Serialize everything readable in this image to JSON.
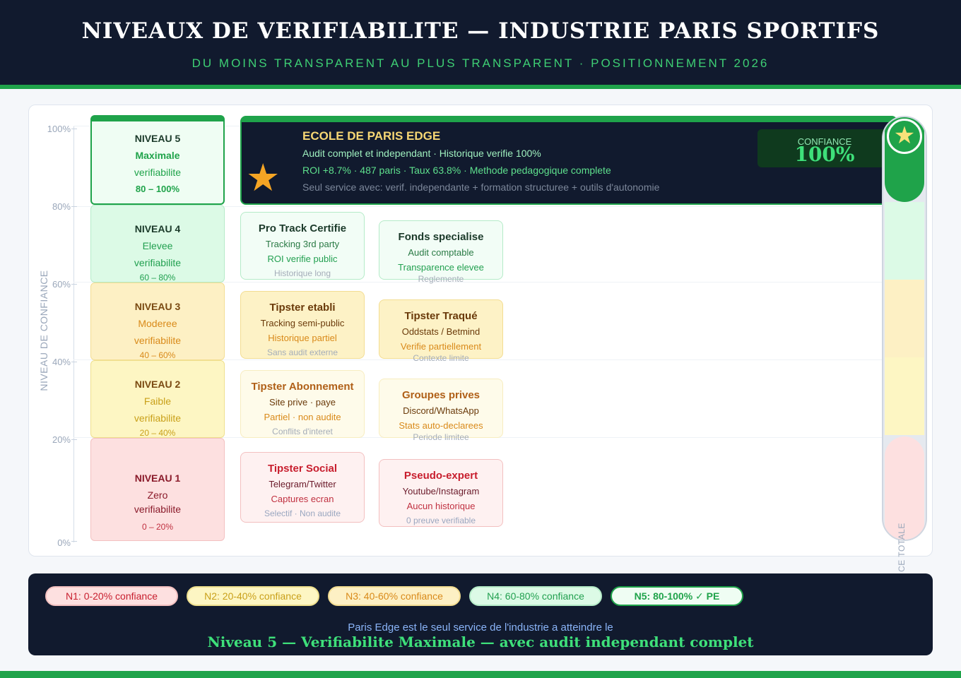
{
  "header": {
    "title": "NIVEAUX DE VERIFIABILITE — INDUSTRIE PARIS SPORTIFS",
    "subtitle": "DU MOINS TRANSPARENT AU PLUS TRANSPARENT · POSITIONNEMENT 2026"
  },
  "axis": {
    "title": "NIVEAU DE CONFIANCE",
    "ticks": [
      "100%",
      "80%",
      "60%",
      "40%",
      "20%",
      "0%"
    ]
  },
  "colors": {
    "navy": "#111a2e",
    "green": "#1fa34a",
    "gold": "#f7d774",
    "n1": "#fde0e0",
    "n2": "#fdf6c3",
    "n3": "#fdf0c4",
    "n4": "#dcfae6",
    "n5": "#effdf3"
  },
  "levels": [
    {
      "title": "NIVEAU 5",
      "name": "Maximale",
      "sub": "verifiabilite",
      "range": "80 – 100%"
    },
    {
      "title": "NIVEAU 4",
      "name": "Elevee",
      "sub": "verifiabilite",
      "range": "60 – 80%"
    },
    {
      "title": "NIVEAU 3",
      "name": "Moderee",
      "sub": "verifiabilite",
      "range": "40 – 60%"
    },
    {
      "title": "NIVEAU 2",
      "name": "Faible",
      "sub": "verifiabilite",
      "range": "20 – 40%"
    },
    {
      "title": "NIVEAU 1",
      "name": "Zero",
      "sub": "verifiabilite",
      "range": "0 – 20%"
    }
  ],
  "edge": {
    "star": "★",
    "name": "ECOLE DE PARIS EDGE",
    "line1": "Audit complet et independant · Historique verifie 100%",
    "line2": "ROI +8.7% · 487 paris · Taux 63.8% · Methode pedagogique complete",
    "line3": "Seul service avec: verif. independante + formation structuree + outils d'autonomie",
    "confidence_label": "CONFIANCE",
    "confidence_value": "100%"
  },
  "services": [
    {
      "level": 4,
      "title": "Pro Track Certifie",
      "l1": "Tracking 3rd party",
      "l2": "ROI verifie public",
      "l3": "Historique long"
    },
    {
      "level": 4,
      "title": "Fonds specialise",
      "l1": "Audit comptable",
      "l2": "Transparence elevee",
      "l3": "Reglemente"
    },
    {
      "level": 3,
      "title": "Tipster etabli",
      "l1": "Tracking semi-public",
      "l2": "Historique partiel",
      "l3": "Sans audit externe"
    },
    {
      "level": 3,
      "title": "Tipster Traqué",
      "l1": "Oddstats / Betmind",
      "l2": "Verifie partiellement",
      "l3": "Contexte limite"
    },
    {
      "level": 2,
      "title": "Tipster Abonnement",
      "l1": "Site prive · paye",
      "l2": "Partiel · non audite",
      "l3": "Conflits d'interet"
    },
    {
      "level": 2,
      "title": "Groupes prives",
      "l1": "Discord/WhatsApp",
      "l2": "Stats auto-declarees",
      "l3": "Periode limitee"
    },
    {
      "level": 1,
      "title": "Tipster Social",
      "l1": "Telegram/Twitter",
      "l2": "Captures ecran",
      "l3": "Selectif · Non audite"
    },
    {
      "level": 1,
      "title": "Pseudo-expert",
      "l1": "Youtube/Instagram",
      "l2": "Aucun historique",
      "l3": "0 preuve verifiable"
    }
  ],
  "thermometer": {
    "label": "CE TOTALE",
    "star": "★",
    "fill_percent": 100
  },
  "legend": [
    "N1: 0-20% confiance",
    "N2: 20-40% confiance",
    "N3: 40-60% confiance",
    "N4: 60-80% confiance",
    "N5: 80-100% ✓ PE"
  ],
  "footer": {
    "line1": "Paris Edge est le seul service de l'industrie a atteindre le",
    "line2": "Niveau 5 — Verifiabilite Maximale — avec audit independant complet"
  }
}
